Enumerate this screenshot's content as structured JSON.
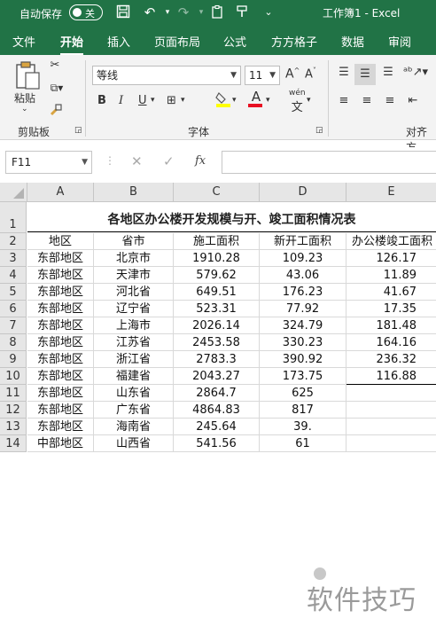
{
  "titlebar": {
    "autosave_label": "自动保存",
    "autosave_state": "关",
    "doc_title": "工作簿1 - Excel",
    "accent": "#217346"
  },
  "tabs": [
    "文件",
    "开始",
    "插入",
    "页面布局",
    "公式",
    "方方格子",
    "数据",
    "审阅"
  ],
  "active_tab": "开始",
  "ribbon": {
    "clipboard": {
      "paste_label": "粘贴",
      "group_label": "剪贴板"
    },
    "font": {
      "font_name": "等线",
      "font_size": "11",
      "grow_font": "A^",
      "shrink_font": "A˅",
      "bold": "B",
      "italic": "I",
      "underline": "U",
      "phonetic": "wén",
      "group_label": "字体"
    },
    "alignment": {
      "group_label": "对齐方"
    }
  },
  "formula_bar": {
    "name_box": "F11",
    "fx": "fx",
    "value": ""
  },
  "sheet": {
    "columns": [
      "A",
      "B",
      "C",
      "D",
      "E"
    ],
    "title": "各地区办公楼开发规模与开、竣工面积情况表",
    "headers": [
      "地区",
      "省市",
      "施工面积",
      "新开工面积",
      "办公楼竣工面积"
    ],
    "rows": [
      {
        "n": "3",
        "region": "东部地区",
        "prov": "北京市",
        "build": "1910.28",
        "new": "109.23",
        "done": "126.17"
      },
      {
        "n": "4",
        "region": "东部地区",
        "prov": "天津市",
        "build": "579.62",
        "new": "43.06",
        "done": "11.89"
      },
      {
        "n": "5",
        "region": "东部地区",
        "prov": "河北省",
        "build": "649.51",
        "new": "176.23",
        "done": "41.67"
      },
      {
        "n": "6",
        "region": "东部地区",
        "prov": "辽宁省",
        "build": "523.31",
        "new": "77.92",
        "done": "17.35"
      },
      {
        "n": "7",
        "region": "东部地区",
        "prov": "上海市",
        "build": "2026.14",
        "new": "324.79",
        "done": "181.48"
      },
      {
        "n": "8",
        "region": "东部地区",
        "prov": "江苏省",
        "build": "2453.58",
        "new": "330.23",
        "done": "164.16"
      },
      {
        "n": "9",
        "region": "东部地区",
        "prov": "浙江省",
        "build": "2783.3",
        "new": "390.92",
        "done": "236.32"
      },
      {
        "n": "10",
        "region": "东部地区",
        "prov": "福建省",
        "build": "2043.27",
        "new": "173.75",
        "done": "116.88"
      },
      {
        "n": "11",
        "region": "东部地区",
        "prov": "山东省",
        "build": "2864.7",
        "new": "625",
        "done": ""
      },
      {
        "n": "12",
        "region": "东部地区",
        "prov": "广东省",
        "build": "4864.83",
        "new": "817",
        "done": ""
      },
      {
        "n": "13",
        "region": "东部地区",
        "prov": "海南省",
        "build": "245.64",
        "new": "39.",
        "done": ""
      },
      {
        "n": "14",
        "region": "中部地区",
        "prov": "山西省",
        "build": "541.56",
        "new": "61",
        "done": ""
      }
    ]
  },
  "watermark": "软件技巧"
}
